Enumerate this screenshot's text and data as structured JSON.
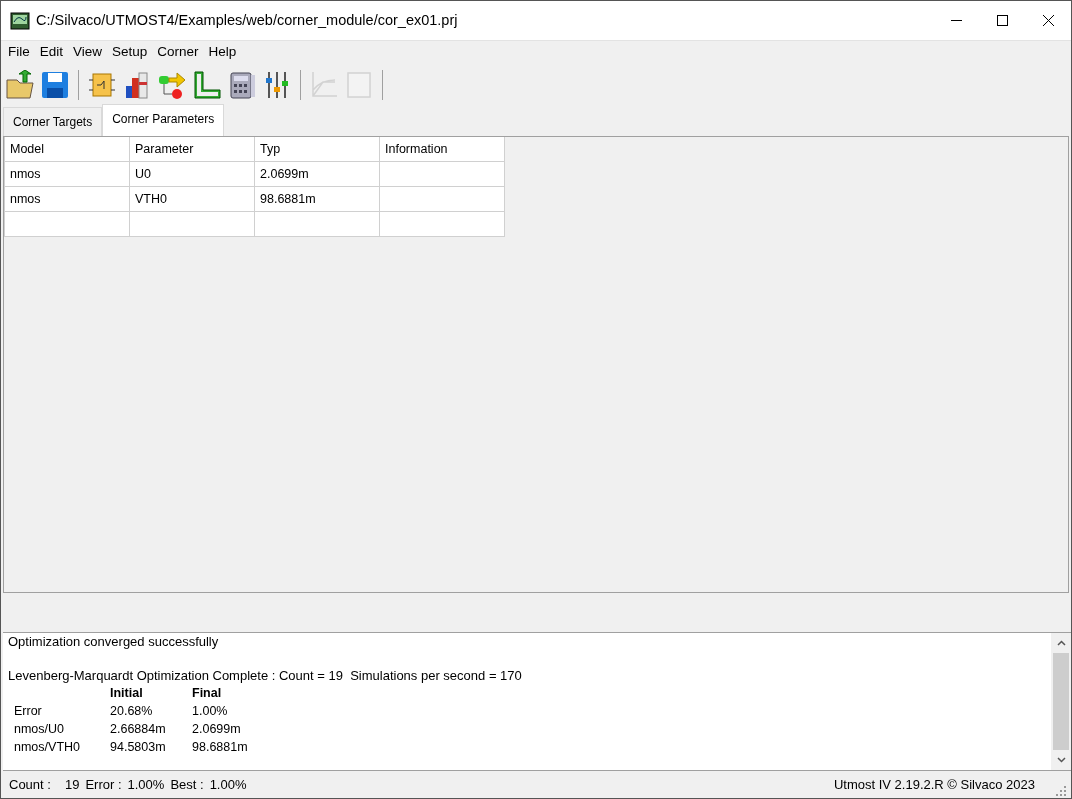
{
  "window": {
    "title": "C:/Silvaco/UTMOST4/Examples/web/corner_module/cor_ex01.prj"
  },
  "menu": [
    "File",
    "Edit",
    "View",
    "Setup",
    "Corner",
    "Help"
  ],
  "toolbar": [
    {
      "kind": "open",
      "disabled": false
    },
    {
      "kind": "save",
      "disabled": false
    },
    {
      "kind": "separator"
    },
    {
      "kind": "circuit",
      "disabled": false
    },
    {
      "kind": "books",
      "disabled": false
    },
    {
      "kind": "flow",
      "disabled": false
    },
    {
      "kind": "ruler",
      "disabled": false
    },
    {
      "kind": "calculator",
      "disabled": false
    },
    {
      "kind": "sliders",
      "disabled": false
    },
    {
      "kind": "separator"
    },
    {
      "kind": "plot",
      "disabled": true
    },
    {
      "kind": "page",
      "disabled": true
    },
    {
      "kind": "separator"
    }
  ],
  "tabs": [
    {
      "label": "Corner Targets",
      "selected": false
    },
    {
      "label": "Corner Parameters",
      "selected": true
    }
  ],
  "table": {
    "columns": [
      "Model",
      "Parameter",
      "Typ",
      "Information"
    ],
    "rows": [
      [
        "nmos",
        "U0",
        "2.0699m"
      ],
      [
        "nmos",
        "VTH0",
        "98.6881m"
      ]
    ]
  },
  "log": {
    "lines": [
      "Optimization converged successfully",
      "Levenberg-Marquardt Optimization Complete : Count = 19  Simulations per second = 170"
    ],
    "summary": {
      "columns": [
        "",
        "Initial",
        "Final"
      ],
      "rows": [
        [
          "Error",
          "20.68%",
          "1.00%"
        ],
        [
          "nmos/U0",
          "2.66884m",
          "2.0699m"
        ],
        [
          "nmos/VTH0",
          "94.5803m",
          "98.6881m"
        ]
      ]
    }
  },
  "status_bar": {
    "items": [
      {
        "label": "Count :",
        "value": "19"
      },
      {
        "label": "Error :",
        "value": "1.00%"
      },
      {
        "label": "Best :",
        "value": "1.00%"
      }
    ],
    "version": "Utmost IV 2.19.2.R © Silvaco 2023"
  }
}
